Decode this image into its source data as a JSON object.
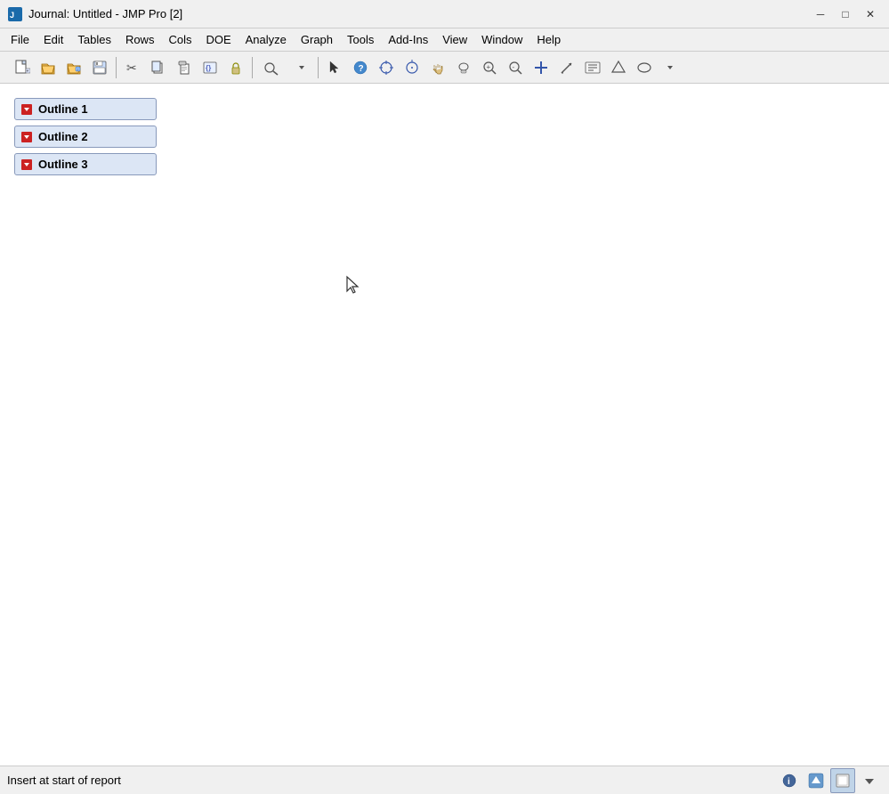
{
  "window": {
    "title": "Journal: Untitled - JMP Pro [2]",
    "minimize_label": "─",
    "maximize_label": "□",
    "close_label": "✕"
  },
  "menu": {
    "items": [
      {
        "label": "File",
        "id": "file"
      },
      {
        "label": "Edit",
        "id": "edit"
      },
      {
        "label": "Tables",
        "id": "tables"
      },
      {
        "label": "Rows",
        "id": "rows"
      },
      {
        "label": "Cols",
        "id": "cols"
      },
      {
        "label": "DOE",
        "id": "doe"
      },
      {
        "label": "Analyze",
        "id": "analyze"
      },
      {
        "label": "Graph",
        "id": "graph"
      },
      {
        "label": "Tools",
        "id": "tools"
      },
      {
        "label": "Add-Ins",
        "id": "addins"
      },
      {
        "label": "View",
        "id": "view"
      },
      {
        "label": "Window",
        "id": "window"
      },
      {
        "label": "Help",
        "id": "help"
      }
    ]
  },
  "outlines": [
    {
      "label": "Outline 1",
      "id": "outline-1"
    },
    {
      "label": "Outline 2",
      "id": "outline-2"
    },
    {
      "label": "Outline 3",
      "id": "outline-3"
    }
  ],
  "status": {
    "text": "Insert at start of report"
  },
  "toolbar": {
    "buttons": [
      {
        "icon": "📄",
        "name": "new-button",
        "title": "New"
      },
      {
        "icon": "📂",
        "name": "open-button",
        "title": "Open"
      },
      {
        "icon": "💾",
        "name": "save-button",
        "title": "Save"
      },
      {
        "icon": "✂️",
        "name": "cut-button",
        "title": "Cut"
      },
      {
        "icon": "📋",
        "name": "copy-button",
        "title": "Copy"
      },
      {
        "icon": "📌",
        "name": "paste-button",
        "title": "Paste"
      },
      {
        "icon": "🔍",
        "name": "search-button",
        "title": "Search"
      },
      {
        "icon": "🖱️",
        "name": "select-button",
        "title": "Select"
      },
      {
        "icon": "❓",
        "name": "help-button",
        "title": "Help"
      },
      {
        "icon": "✚",
        "name": "crosshair-button",
        "title": "Crosshair"
      },
      {
        "icon": "🎯",
        "name": "lasso-button",
        "title": "Lasso"
      },
      {
        "icon": "✏️",
        "name": "brush-button",
        "title": "Brush"
      },
      {
        "icon": "🔎",
        "name": "zoom-button",
        "title": "Zoom"
      },
      {
        "icon": "➕",
        "name": "add-button",
        "title": "Add"
      },
      {
        "icon": "📏",
        "name": "annotate-button",
        "title": "Annotate"
      }
    ]
  }
}
